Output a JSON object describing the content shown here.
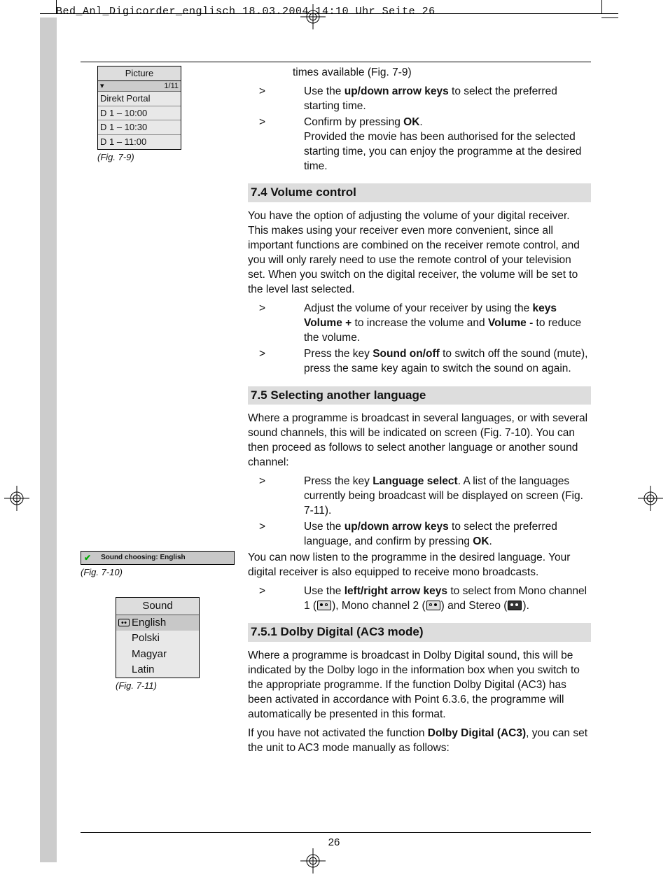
{
  "slug": "Bed_Anl_Digicorder_englisch  18.03.2004  14:10 Uhr  Seite 26",
  "page_number": "26",
  "fig79": {
    "title": "Picture",
    "counter_left": "▾",
    "counter_right": "1/11",
    "rows": [
      "Direkt Portal",
      "D 1 – 10:00",
      "D 1 – 10:30",
      "D 1 – 11:00"
    ],
    "caption": "(Fig. 7-9)"
  },
  "fig710": {
    "check": "✔",
    "label": "Sound choosing: English",
    "caption": "(Fig. 7-10)"
  },
  "fig711": {
    "title": "Sound",
    "rows": [
      "English",
      "Polski",
      "Magyar",
      "Latin"
    ],
    "caption": "(Fig. 7-11)"
  },
  "intro": {
    "line1": "times available (Fig. 7-9)",
    "step1a": "Use the ",
    "step1b": "up/down arrow keys",
    "step1c": " to select the preferred starting time.",
    "step2a": "Confirm by pressing ",
    "step2b": "OK",
    "step2c": ".",
    "step2d": "Provided the movie has been authorised for the selected starting time, you can enjoy the programme at the desired time."
  },
  "s74": {
    "heading": "7.4 Volume control",
    "para": "You have the option of adjusting the volume of your digital receiver. This makes using your receiver even more convenient, since all important functions are combined on the receiver remote control, and you will only rarely need to use the remote control of your television set. When you switch on the digital receiver, the volume will be set to the level last selected.",
    "step1a": "Adjust the volume of your receiver by using the ",
    "step1b": "keys Volume +",
    "step1c": " to increase the volume and ",
    "step1d": "Volume -",
    "step1e": " to reduce the volume.",
    "step2a": "Press the key ",
    "step2b": "Sound on/off",
    "step2c": " to switch off the sound (mute), press the same key again to switch the sound on again."
  },
  "s75": {
    "heading": "7.5 Selecting another language",
    "para": "Where a programme is broadcast in several languages, or with several sound channels, this will be indicated on screen (Fig. 7-10). You can then proceed as follows to select another language or another sound channel:",
    "step1a": "Press the key ",
    "step1b": "Language select",
    "step1c": ". A list of the languages currently being broadcast will be displayed on screen (Fig. 7-11).",
    "step2a": "Use the ",
    "step2b": "up/down arrow keys",
    "step2c": " to select the preferred language, and confirm by pressing ",
    "step2d": "OK",
    "step2e": ".",
    "para2": "You can now listen to the programme in the desired language. Your digital receiver is also equipped to receive mono broadcasts.",
    "step3a": "Use the ",
    "step3b": "left/right arrow keys",
    "step3c": " to select from Mono channel 1 (",
    "step3d": "), Mono channel 2 (",
    "step3e": ") and Stereo (",
    "step3f": ")."
  },
  "s751": {
    "heading": "7.5.1 Dolby Digital (AC3 mode)",
    "para1": "Where a programme is broadcast in Dolby Digital sound, this will be indicated by the Dolby logo in the information box when you switch to the appropriate programme. If the function Dolby Digital (AC3) has been activated in accordance with Point 6.3.6, the programme will automatically be presented in this format.",
    "para2a": "If you have not activated the function ",
    "para2b": "Dolby Digital (AC3)",
    "para2c": ", you can set the unit to AC3 mode manually as follows:"
  },
  "marker": ">"
}
